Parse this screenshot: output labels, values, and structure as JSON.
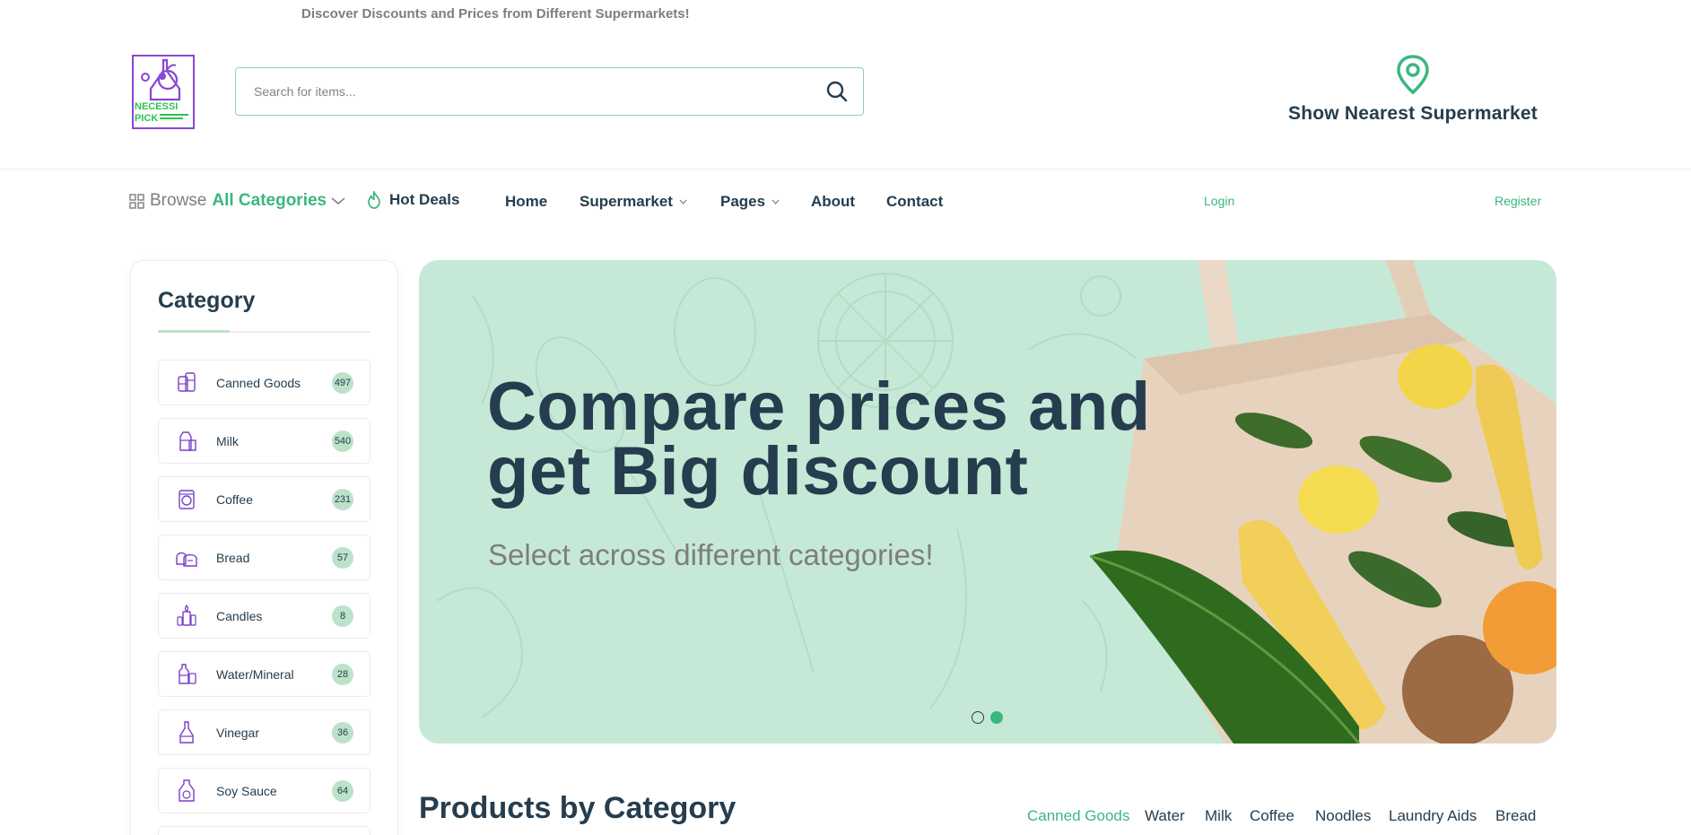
{
  "header": {
    "tagline": "Discover Discounts and Prices from Different Supermarkets!",
    "logo_text": "NECESSI PICK",
    "search_placeholder": "Search for items...",
    "nearest_label": "Show Nearest Supermarket"
  },
  "nav": {
    "browse_word": "Browse",
    "browse_categories": "All Categories",
    "hot_deals": "Hot Deals",
    "links": {
      "home": "Home",
      "supermarket": "Supermarket",
      "pages": "Pages",
      "about": "About",
      "contact": "Contact"
    },
    "login": "Login",
    "register": "Register"
  },
  "sidebar": {
    "title": "Category",
    "items": [
      {
        "label": "Canned Goods",
        "count": "497",
        "icon": "canned-goods-icon"
      },
      {
        "label": "Milk",
        "count": "540",
        "icon": "milk-icon"
      },
      {
        "label": "Coffee",
        "count": "231",
        "icon": "coffee-icon"
      },
      {
        "label": "Bread",
        "count": "57",
        "icon": "bread-icon"
      },
      {
        "label": "Candles",
        "count": "8",
        "icon": "candles-icon"
      },
      {
        "label": "Water/Mineral",
        "count": "28",
        "icon": "water-icon"
      },
      {
        "label": "Vinegar",
        "count": "36",
        "icon": "vinegar-icon"
      },
      {
        "label": "Soy Sauce",
        "count": "64",
        "icon": "soy-sauce-icon"
      }
    ]
  },
  "hero": {
    "headline_line1": "Compare prices and",
    "headline_line2": "get Big discount",
    "subtitle": "Select across different categories!",
    "active_slide": 2,
    "slide_count": 2
  },
  "products": {
    "title": "Products by Category",
    "tabs": [
      "Canned Goods",
      "Water",
      "Milk",
      "Coffee",
      "Noodles",
      "Laundry Aids",
      "Bread"
    ],
    "active_tab": "Canned Goods"
  },
  "colors": {
    "brand_green": "#3bb77e",
    "heading": "#253d4e",
    "muted": "#7e7e7e",
    "hero_bg": "#c6e9d7",
    "badge_bg": "#bce3c9",
    "icon_purple": "#7a3fc9"
  }
}
